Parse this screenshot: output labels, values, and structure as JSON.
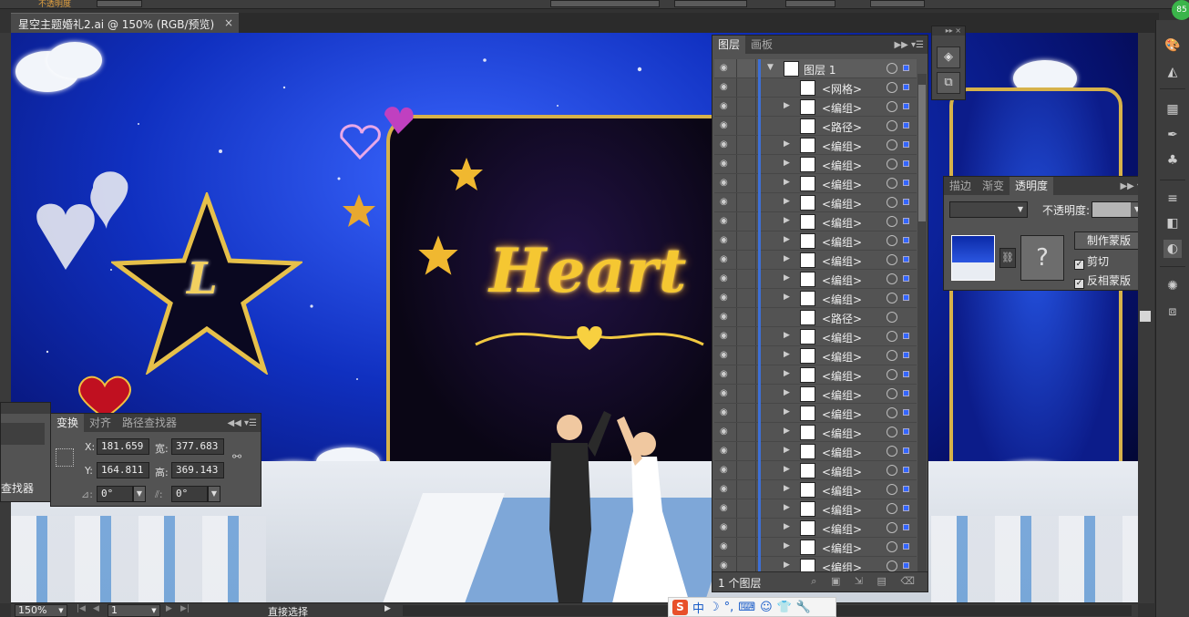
{
  "document": {
    "tab_title": "星空主题婚礼2.ai @ 150% (RGB/预览)",
    "tab_close": "×"
  },
  "control_bar": {
    "opacity_label": "不透明度"
  },
  "artwork": {
    "heart_text": "Heart",
    "star_letter": "L"
  },
  "transform_panel": {
    "tabs": [
      "变换",
      "对齐",
      "路径查找器"
    ],
    "x_label": "X:",
    "x_value": "181.659",
    "y_label": "Y:",
    "y_value": "164.811",
    "w_label": "宽:",
    "w_value": "377.683",
    "h_label": "高:",
    "h_value": "369.143",
    "rotate_value": "0°",
    "shear_value": "0°"
  },
  "left_float": {
    "text": "查找器"
  },
  "layers_panel": {
    "tabs": [
      "图层",
      "画板"
    ],
    "top_layer": "图层 1",
    "rows": [
      "<网格>",
      "<编组>",
      "<路径>",
      "<编组>",
      "<编组>",
      "<编组>",
      "<编组>",
      "<编组>",
      "<编组>",
      "<编组>",
      "<编组>",
      "<编组>",
      "<路径>",
      "<编组>",
      "<编组>",
      "<编组>",
      "<编组>",
      "<编组>",
      "<编组>",
      "<编组>",
      "<编组>",
      "<编组>",
      "<编组>",
      "<编组>",
      "<编组>",
      "<编组>"
    ],
    "footer": "1 个图层"
  },
  "transparency_panel": {
    "tabs": [
      "描边",
      "渐变",
      "透明度"
    ],
    "opacity_label": "不透明度:",
    "make_mask": "制作蒙版",
    "clip": "剪切",
    "invert_mask": "反相蒙版",
    "empty_mask": "?"
  },
  "status_bar": {
    "zoom": "150%",
    "artboard": "1",
    "tool": "直接选择"
  },
  "ime_bar": {
    "logo": "S",
    "mode": "中"
  },
  "badge": "85"
}
